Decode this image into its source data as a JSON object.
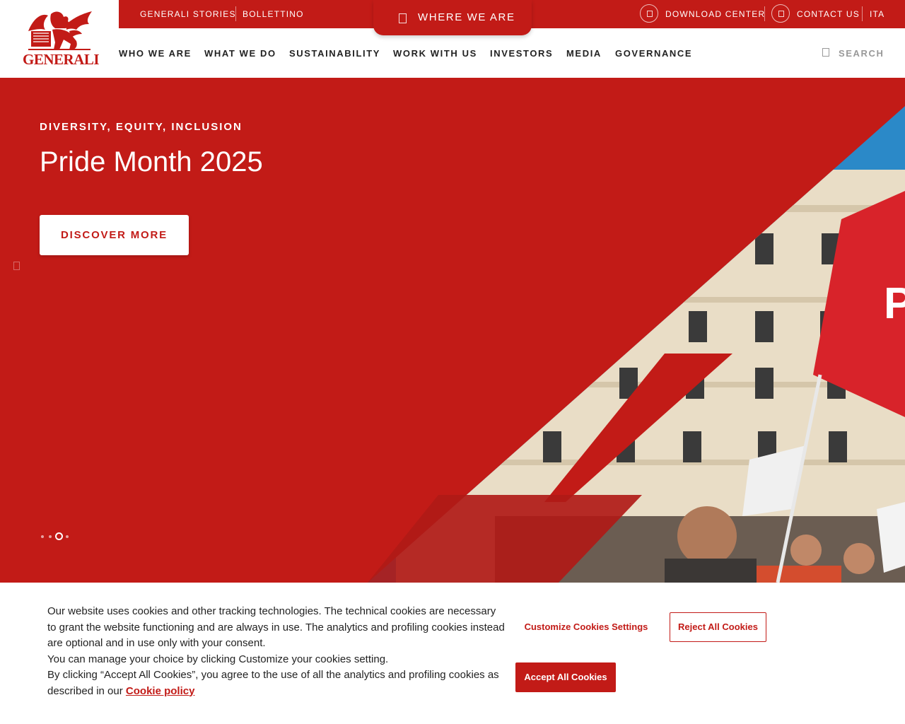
{
  "brand": {
    "name": "GENERALI",
    "color": "#c21b17",
    "logo_icon": "winged-lion-icon"
  },
  "topbar": {
    "links": [
      "GENERALI STORIES",
      "BOLLETTINO"
    ],
    "where_we_are": "WHERE WE ARE",
    "download_center": "DOWNLOAD CENTER",
    "contact_us": "CONTACT US",
    "language": "ITA"
  },
  "nav": {
    "items": [
      "WHO WE ARE",
      "WHAT WE DO",
      "SUSTAINABILITY",
      "WORK WITH US",
      "INVESTORS",
      "MEDIA",
      "GOVERNANCE"
    ],
    "search_label": "SEARCH"
  },
  "hero": {
    "eyebrow": "DIVERSITY, EQUITY, INCLUSION",
    "title": "Pride Month 2025",
    "cta": "DISCOVER MORE",
    "slide_count": 4,
    "active_slide": 3
  },
  "cookie_banner": {
    "line1": "Our website uses cookies and other tracking technologies. The technical cookies are necessary to grant the website functioning and are always in use. The analytics and profiling cookies instead are optional and in use only with your consent.",
    "line2": "You can manage your choice by clicking Customize your cookies setting.",
    "line3": "By clicking “Accept All Cookies”, you agree to the use of all the analytics and profiling cookies as described in our",
    "policy_link": "Cookie policy",
    "customize_label": "Customize Cookies Settings",
    "reject_label": "Reject All Cookies",
    "accept_label": "Accept All Cookies"
  }
}
